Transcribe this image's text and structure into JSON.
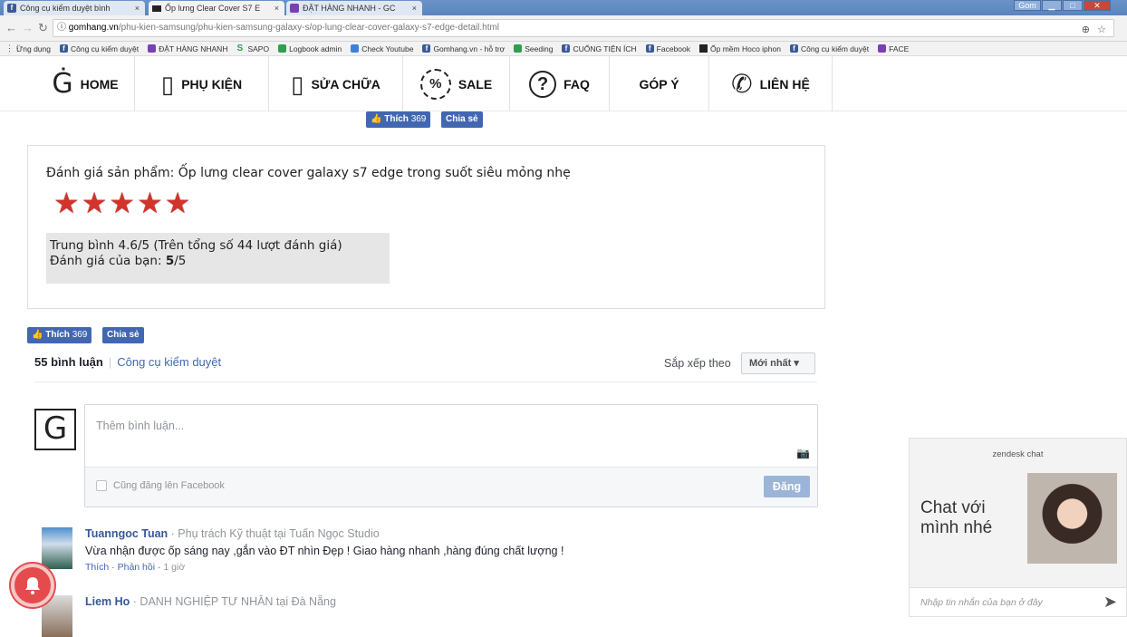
{
  "browser": {
    "tabs": [
      {
        "label": "Công cụ kiểm duyệt bình",
        "icon": "facebook-icon"
      },
      {
        "label": "Ốp lưng Clear Cover S7 E",
        "icon": "shop-icon"
      },
      {
        "label": "ĐẶT HÀNG NHANH - GC",
        "icon": "sheets-icon"
      }
    ],
    "close_glyph": "×",
    "window_user": "Gom",
    "url_host": "gomhang.vn",
    "url_path": "/phu-kien-samsung/phu-kien-samsung-galaxy-s/op-lung-clear-cover-galaxy-s7-edge-detail.html",
    "bookmarks": [
      {
        "label": "Ứng dụng",
        "icon": "apps-icon"
      },
      {
        "label": "Công cụ kiểm duyệt",
        "icon": "facebook-icon"
      },
      {
        "label": "ĐẶT HÀNG NHANH",
        "icon": "sheets-icon"
      },
      {
        "label": "SAPO",
        "icon": "sapo-icon"
      },
      {
        "label": "Logbook admin",
        "icon": "sheets-green-icon"
      },
      {
        "label": "Check Youtube",
        "icon": "docs-icon"
      },
      {
        "label": "Gomhang.vn - hỗ trợ",
        "icon": "facebook-icon"
      },
      {
        "label": "Seeding",
        "icon": "sheets-green-icon"
      },
      {
        "label": "CUỐNG TIỆN ÍCH",
        "icon": "facebook-icon"
      },
      {
        "label": "Facebook",
        "icon": "facebook-icon"
      },
      {
        "label": "Ốp mềm Hoco iphon",
        "icon": "shop-icon"
      },
      {
        "label": "Công cụ kiểm duyệt",
        "icon": "facebook-icon"
      },
      {
        "label": "FACE",
        "icon": "sheets-icon"
      }
    ]
  },
  "site_nav": {
    "items": [
      {
        "label": "HOME",
        "icon": "g-logo-icon"
      },
      {
        "label": "PHỤ KIỆN",
        "icon": "phone-icon"
      },
      {
        "label": "SỬA CHỮA",
        "icon": "repair-icon"
      },
      {
        "label": "SALE",
        "icon": "sale-badge-icon"
      },
      {
        "label": "FAQ",
        "icon": "question-icon"
      },
      {
        "label": "GÓP Ý",
        "icon": ""
      },
      {
        "label": "LIÊN HỆ",
        "icon": "phone-handset-icon"
      }
    ]
  },
  "share": {
    "like_label": "Thích",
    "like_count": "369",
    "share_label": "Chia sẻ"
  },
  "rating": {
    "title": "Đánh giá sản phẩm: Ốp lưng clear cover galaxy s7 edge trong suốt siêu mỏng nhẹ",
    "stars": 5,
    "average_text": "Trung bình 4.6/5 (Trên tổng số 44 lượt đánh giá)",
    "your_rating_label": "Đánh giá của bạn:",
    "your_rating_value": "5",
    "your_rating_suffix": "/5"
  },
  "comments": {
    "count_label": "55 bình luận",
    "moderation_link": "Công cụ kiểm duyệt",
    "sort_label": "Sắp xếp theo",
    "sort_value": "Mới nhất",
    "composer_placeholder": "Thêm bình luận...",
    "also_post_label": "Cũng đăng lên Facebook",
    "post_button": "Đăng",
    "items": [
      {
        "name": "Tuanngoc Tuan",
        "role": " · Phụ trách Kỹ thuật tại Tuấn Ngọc Studio",
        "text": "Vừa nhận được ốp sáng nay ,gắn vào ĐT nhìn Đẹp ! Giao hàng nhanh ,hàng đúng chất lượng !",
        "like": "Thích",
        "reply": "Phản hồi",
        "time": "1 giờ"
      },
      {
        "name": "Liem Ho",
        "role": " · DANH NGHIỆP TƯ NHÂN tại Đà Nẵng",
        "text": "",
        "like": "",
        "reply": "",
        "time": ""
      }
    ]
  },
  "chat": {
    "title": "zendesk chat",
    "message": "Chat với mình nhé",
    "input_placeholder": "Nhập tin nhắn của bạn ở đây"
  },
  "colors": {
    "facebook_blue": "#4267b2",
    "star_red": "#d2332b",
    "bell_red": "#e54b4d"
  }
}
